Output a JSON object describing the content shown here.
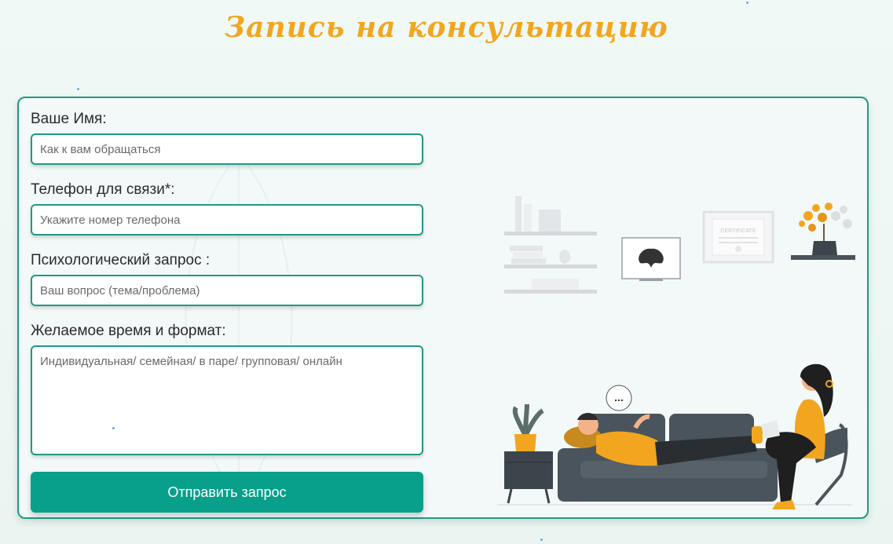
{
  "header": {
    "title": "Запись на консультацию"
  },
  "form": {
    "name": {
      "label": "Ваше Имя:",
      "placeholder": "Как к вам обращаться"
    },
    "phone": {
      "label": "Телефон для связи*:",
      "placeholder": "Укажите номер телефона"
    },
    "request": {
      "label": "Психологический запрос :",
      "placeholder": "Ваш вопрос (тема/проблема)"
    },
    "time": {
      "label": "Желаемое время и формат:",
      "placeholder": "Индивидуальная/ семейная/ в паре/ групповая/ онлайн"
    },
    "submit_label": "Отправить запрос"
  },
  "illustration": {
    "certificate_text": "CERTIFICATE",
    "speech_bubble": "...",
    "colors": {
      "accent": "#f2a61f",
      "sofa": "#4a545c",
      "teal": "#1e9a86"
    }
  }
}
